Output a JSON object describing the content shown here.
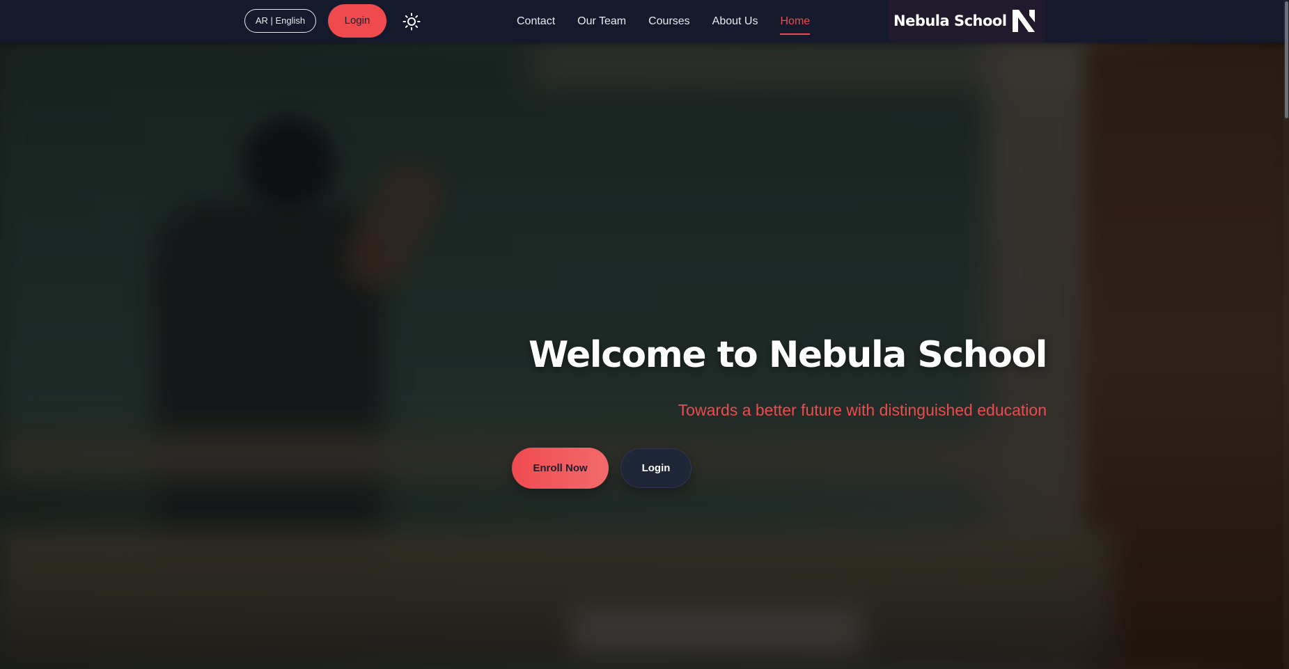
{
  "navbar": {
    "language_toggle": "AR | English",
    "login_label": "Login",
    "theme_icon": "sun-icon",
    "links": [
      {
        "label": "Contact"
      },
      {
        "label": "Our Team"
      },
      {
        "label": "Courses"
      },
      {
        "label": "About Us"
      },
      {
        "label": "Home",
        "active": true
      }
    ]
  },
  "brand": {
    "name": "Nebula School",
    "logo_icon": "nebula-n-logo"
  },
  "hero": {
    "title": "Welcome to Nebula School",
    "subtitle": "Towards a better future with distinguished education",
    "enroll_label": "Enroll Now",
    "login_label": "Login",
    "background_image": "blurred classroom"
  },
  "colors": {
    "accent": "#ef4b4f",
    "navbar_bg": "#141a2b",
    "dark_button": "#1f2638",
    "text_light": "#ffffff"
  }
}
